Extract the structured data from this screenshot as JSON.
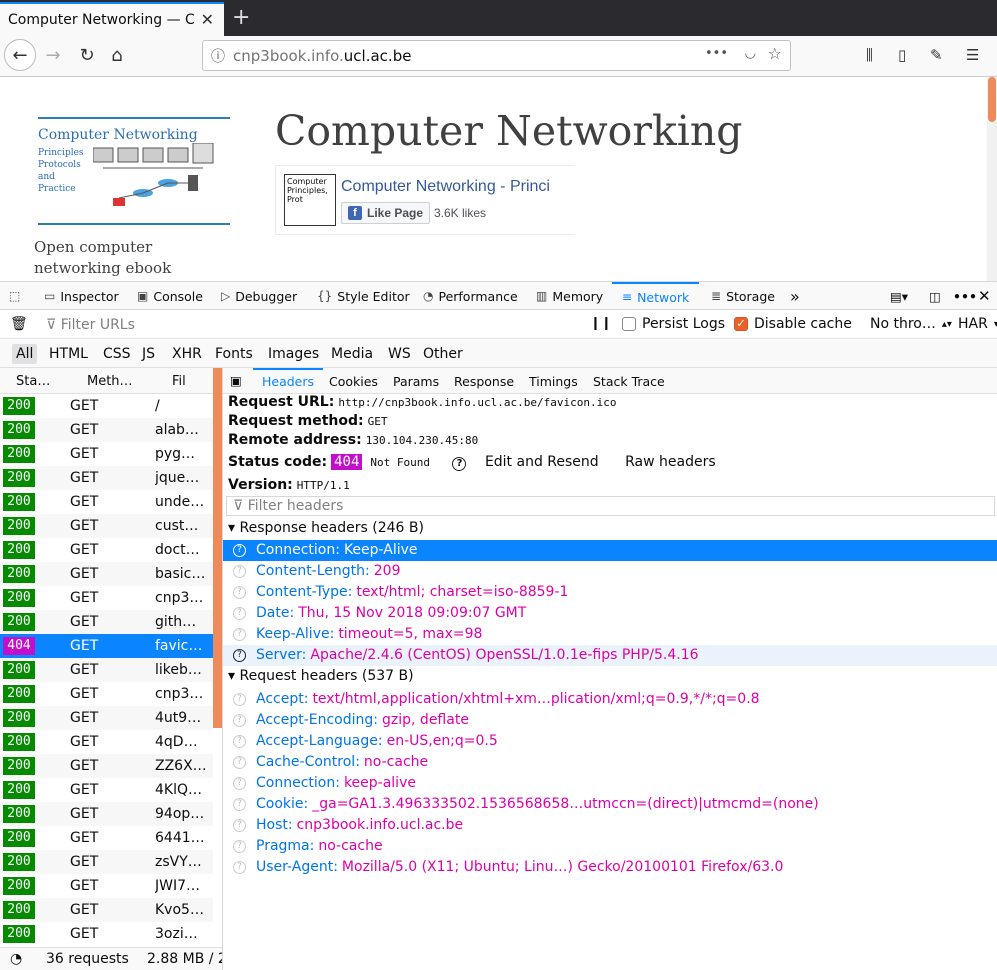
{
  "browser": {
    "tab_title": "Computer Networking — C",
    "url_host_prefix": "cnp3book.info.",
    "url_host_domain": "ucl.ac.be"
  },
  "page": {
    "title": "Computer Networking",
    "tagline": "Open computer networking ebook",
    "logo_title": "Computer Networking",
    "logo_subtitle": [
      "Principles",
      "Protocols",
      "and",
      "Practice"
    ],
    "fb_name": "Computer Networking - Princi",
    "fb_like": "Like Page",
    "fb_count": "3.6K likes",
    "fb_thumb": "Computer Principles, Prot"
  },
  "devtools": {
    "tabs": [
      "Inspector",
      "Console",
      "Debugger",
      "Style Editor",
      "Performance",
      "Memory",
      "Network",
      "Storage"
    ],
    "filter_placeholder": "Filter URLs",
    "persist_logs": "Persist Logs",
    "disable_cache": "Disable cache",
    "throttle": "No thro…",
    "har": "HAR",
    "type_filters": [
      "All",
      "HTML",
      "CSS",
      "JS",
      "XHR",
      "Fonts",
      "Images",
      "Media",
      "WS",
      "Other"
    ],
    "columns": {
      "status": "Sta…",
      "method": "Meth…",
      "file": "Fil"
    },
    "requests": [
      {
        "status": "200",
        "method": "GET",
        "file": "/"
      },
      {
        "status": "200",
        "method": "GET",
        "file": "alab…"
      },
      {
        "status": "200",
        "method": "GET",
        "file": "pyg…"
      },
      {
        "status": "200",
        "method": "GET",
        "file": "jque…"
      },
      {
        "status": "200",
        "method": "GET",
        "file": "unde…"
      },
      {
        "status": "200",
        "method": "GET",
        "file": "cust…"
      },
      {
        "status": "200",
        "method": "GET",
        "file": "doct…"
      },
      {
        "status": "200",
        "method": "GET",
        "file": "basic…"
      },
      {
        "status": "200",
        "method": "GET",
        "file": "cnp3…"
      },
      {
        "status": "200",
        "method": "GET",
        "file": "gith…"
      },
      {
        "status": "404",
        "method": "GET",
        "file": "favic…"
      },
      {
        "status": "200",
        "method": "GET",
        "file": "likeb…"
      },
      {
        "status": "200",
        "method": "GET",
        "file": "cnp3…"
      },
      {
        "status": "200",
        "method": "GET",
        "file": "4ut9…"
      },
      {
        "status": "200",
        "method": "GET",
        "file": "4qD…"
      },
      {
        "status": "200",
        "method": "GET",
        "file": "ZZ6X…"
      },
      {
        "status": "200",
        "method": "GET",
        "file": "4KlQ…"
      },
      {
        "status": "200",
        "method": "GET",
        "file": "94op…"
      },
      {
        "status": "200",
        "method": "GET",
        "file": "6441…"
      },
      {
        "status": "200",
        "method": "GET",
        "file": "zsVY…"
      },
      {
        "status": "200",
        "method": "GET",
        "file": "JWI7…"
      },
      {
        "status": "200",
        "method": "GET",
        "file": "Kvo5…"
      },
      {
        "status": "200",
        "method": "GET",
        "file": "3ozi…"
      }
    ],
    "status_requests": "36 requests",
    "status_size": "2.88 MB / 2",
    "detail_tabs": [
      "Headers",
      "Cookies",
      "Params",
      "Response",
      "Timings",
      "Stack Trace"
    ],
    "summary": {
      "request_url_label": "Request URL:",
      "request_url": "http://cnp3book.info.ucl.ac.be/favicon.ico",
      "method_label": "Request method:",
      "method": "GET",
      "remote_label": "Remote address:",
      "remote": "130.104.230.45:80",
      "status_label": "Status code:",
      "status_code": "404",
      "status_text": "Not Found",
      "edit_resend": "Edit and Resend",
      "raw_headers": "Raw headers",
      "version_label": "Version:",
      "version": "HTTP/1.1"
    },
    "headers_filter": "Filter headers",
    "response_section": "Response headers (246 B)",
    "response_headers": [
      {
        "k": "Connection:",
        "v": "Keep-Alive"
      },
      {
        "k": "Content-Length:",
        "v": "209"
      },
      {
        "k": "Content-Type:",
        "v": "text/html; charset=iso-8859-1"
      },
      {
        "k": "Date:",
        "v": "Thu, 15 Nov 2018 09:09:07 GMT"
      },
      {
        "k": "Keep-Alive:",
        "v": "timeout=5, max=98"
      },
      {
        "k": "Server:",
        "v": "Apache/2.4.6 (CentOS) OpenSSL/1.0.1e-fips PHP/5.4.16"
      }
    ],
    "request_section": "Request headers (537 B)",
    "request_headers": [
      {
        "k": "Accept:",
        "v": "text/html,application/xhtml+xm…plication/xml;q=0.9,*/*;q=0.8"
      },
      {
        "k": "Accept-Encoding:",
        "v": "gzip, deflate"
      },
      {
        "k": "Accept-Language:",
        "v": "en-US,en;q=0.5"
      },
      {
        "k": "Cache-Control:",
        "v": "no-cache"
      },
      {
        "k": "Connection:",
        "v": "keep-alive"
      },
      {
        "k": "Cookie:",
        "v": "_ga=GA1.3.496333502.1536568658…utmccn=(direct)|utmcmd=(none)"
      },
      {
        "k": "Host:",
        "v": "cnp3book.info.ucl.ac.be"
      },
      {
        "k": "Pragma:",
        "v": "no-cache"
      },
      {
        "k": "User-Agent:",
        "v": "Mozilla/5.0 (X11; Ubuntu; Linu…) Gecko/20100101 Firefox/63.0"
      }
    ]
  }
}
